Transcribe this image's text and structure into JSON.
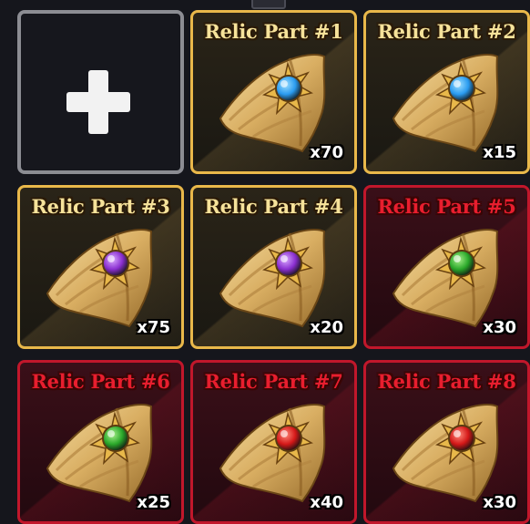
{
  "add_slot": {
    "icon": "plus-icon"
  },
  "items": [
    {
      "name": "Relic Part #1",
      "count": "x70",
      "rarity": "gold",
      "gem_color": "#2a9bf0",
      "gem_light": "#9fe0ff"
    },
    {
      "name": "Relic Part #2",
      "count": "x15",
      "rarity": "gold",
      "gem_color": "#2a9bf0",
      "gem_light": "#9fe0ff"
    },
    {
      "name": "Relic Part #3",
      "count": "x75",
      "rarity": "gold",
      "gem_color": "#8a2fd0",
      "gem_light": "#d9a8ff"
    },
    {
      "name": "Relic Part #4",
      "count": "x20",
      "rarity": "gold",
      "gem_color": "#8a2fd0",
      "gem_light": "#d9a8ff"
    },
    {
      "name": "Relic Part #5",
      "count": "x30",
      "rarity": "red",
      "gem_color": "#2aa82a",
      "gem_light": "#a8f08a"
    },
    {
      "name": "Relic Part #6",
      "count": "x25",
      "rarity": "red",
      "gem_color": "#2aa82a",
      "gem_light": "#a8f08a"
    },
    {
      "name": "Relic Part #7",
      "count": "x40",
      "rarity": "red",
      "gem_color": "#d41818",
      "gem_light": "#ff8a7a"
    },
    {
      "name": "Relic Part #8",
      "count": "x30",
      "rarity": "red",
      "gem_color": "#d41818",
      "gem_light": "#ff8a7a"
    }
  ],
  "colors": {
    "gold_border": "#e9b84a",
    "red_border": "#c1172b",
    "gold_text": "#f6e29a",
    "red_text": "#e81e2e"
  }
}
